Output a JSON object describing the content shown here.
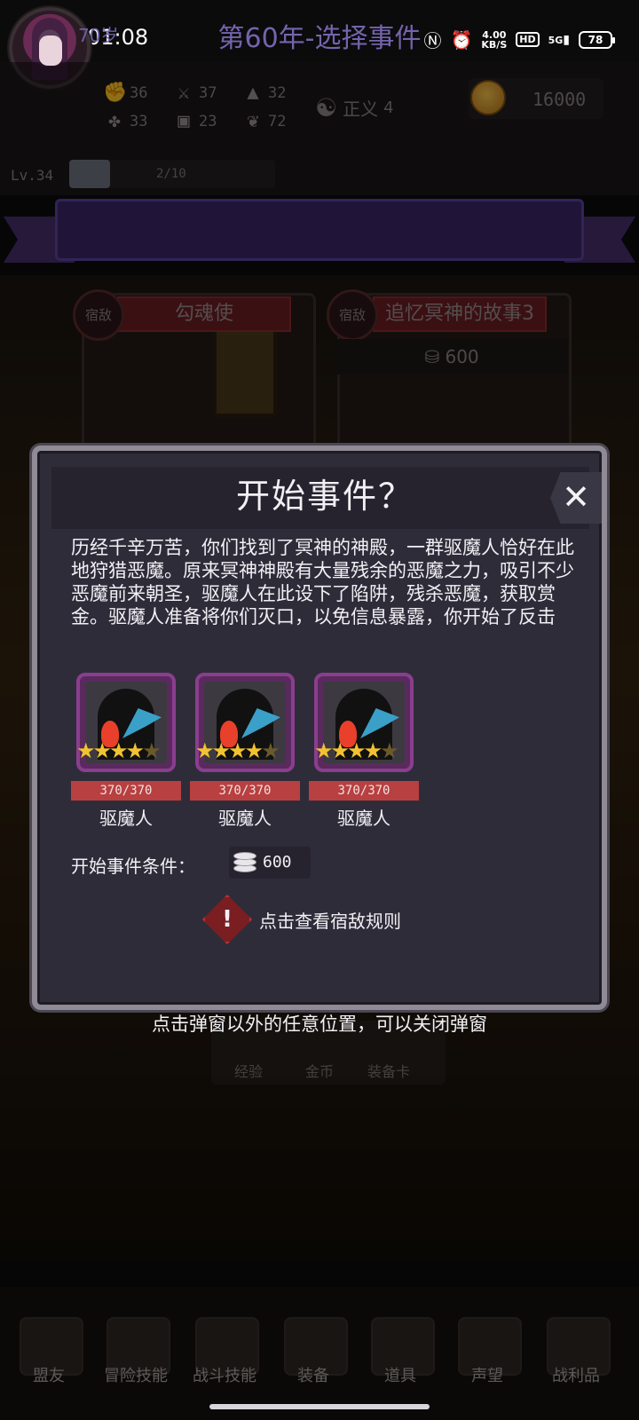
{
  "status_bar": {
    "time": "01:08",
    "speed_value": "4.00",
    "speed_unit": "KB/S",
    "hd": "HD",
    "network": "5G",
    "battery": "78"
  },
  "header": {
    "stats": [
      {
        "icon": "fist-icon",
        "value": "36"
      },
      {
        "icon": "sword-icon",
        "value": "37"
      },
      {
        "icon": "wizard-hat-icon",
        "value": "32"
      },
      {
        "icon": "clover-icon",
        "value": "33"
      },
      {
        "icon": "armor-icon",
        "value": "23"
      },
      {
        "icon": "leaf-icon",
        "value": "72"
      }
    ],
    "alignment_label": "正义",
    "alignment_value": "4",
    "coins": "16000",
    "level": "Lv.34",
    "level_progress_text": "2/10",
    "level_progress": 0.2
  },
  "banner": {
    "age": "70岁",
    "title": "第60年-选择事件"
  },
  "event_cards": [
    {
      "tag": "宿敌",
      "title": "勾魂使"
    },
    {
      "tag": "宿敌",
      "title": "追忆冥神的故事3",
      "cost": "600"
    }
  ],
  "modal": {
    "title": "开始事件？",
    "close": "✕",
    "description": "历经千辛万苦，你们找到了冥神的神殿，一群驱魔人恰好在此地狩猎恶魔。原来冥神神殿有大量残余的恶魔之力，吸引不少恶魔前来朝圣，驱魔人在此设下了陷阱，残杀恶魔，获取赏金。驱魔人准备将你们灭口，以免信息暴露，你开始了反击",
    "enemies": [
      {
        "name": "驱魔人",
        "hp": "370/370",
        "stars": 4,
        "max_stars": 5
      },
      {
        "name": "驱魔人",
        "hp": "370/370",
        "stars": 4,
        "max_stars": 5
      },
      {
        "name": "驱魔人",
        "hp": "370/370",
        "stars": 4,
        "max_stars": 5
      }
    ],
    "condition_label": "开始事件条件：",
    "condition_cost": "600",
    "rule_link": "点击查看宿敌规则",
    "warn_icon": "!"
  },
  "close_hint": "点击弹窗以外的任意位置，可以关闭弹窗",
  "rewards": [
    "经验",
    "金币",
    "装备卡"
  ],
  "bottom_nav": [
    {
      "label": "盟友",
      "icon": "ally-icon"
    },
    {
      "label": "冒险技能",
      "icon": "spellbook-icon"
    },
    {
      "label": "战斗技能",
      "icon": "backpack-icon"
    },
    {
      "label": "装备",
      "icon": "crossed-swords-icon"
    },
    {
      "label": "道具",
      "icon": "bag-icon"
    },
    {
      "label": "声望",
      "icon": "scroll-icon"
    },
    {
      "label": "战利品",
      "icon": "treasure-chest-icon"
    }
  ],
  "colors": {
    "modal_bg": "#2f2c3a",
    "banner_bg": "#3b2766",
    "hp_bar": "#b84040",
    "star": "#f2c230",
    "warn": "#b83034"
  }
}
